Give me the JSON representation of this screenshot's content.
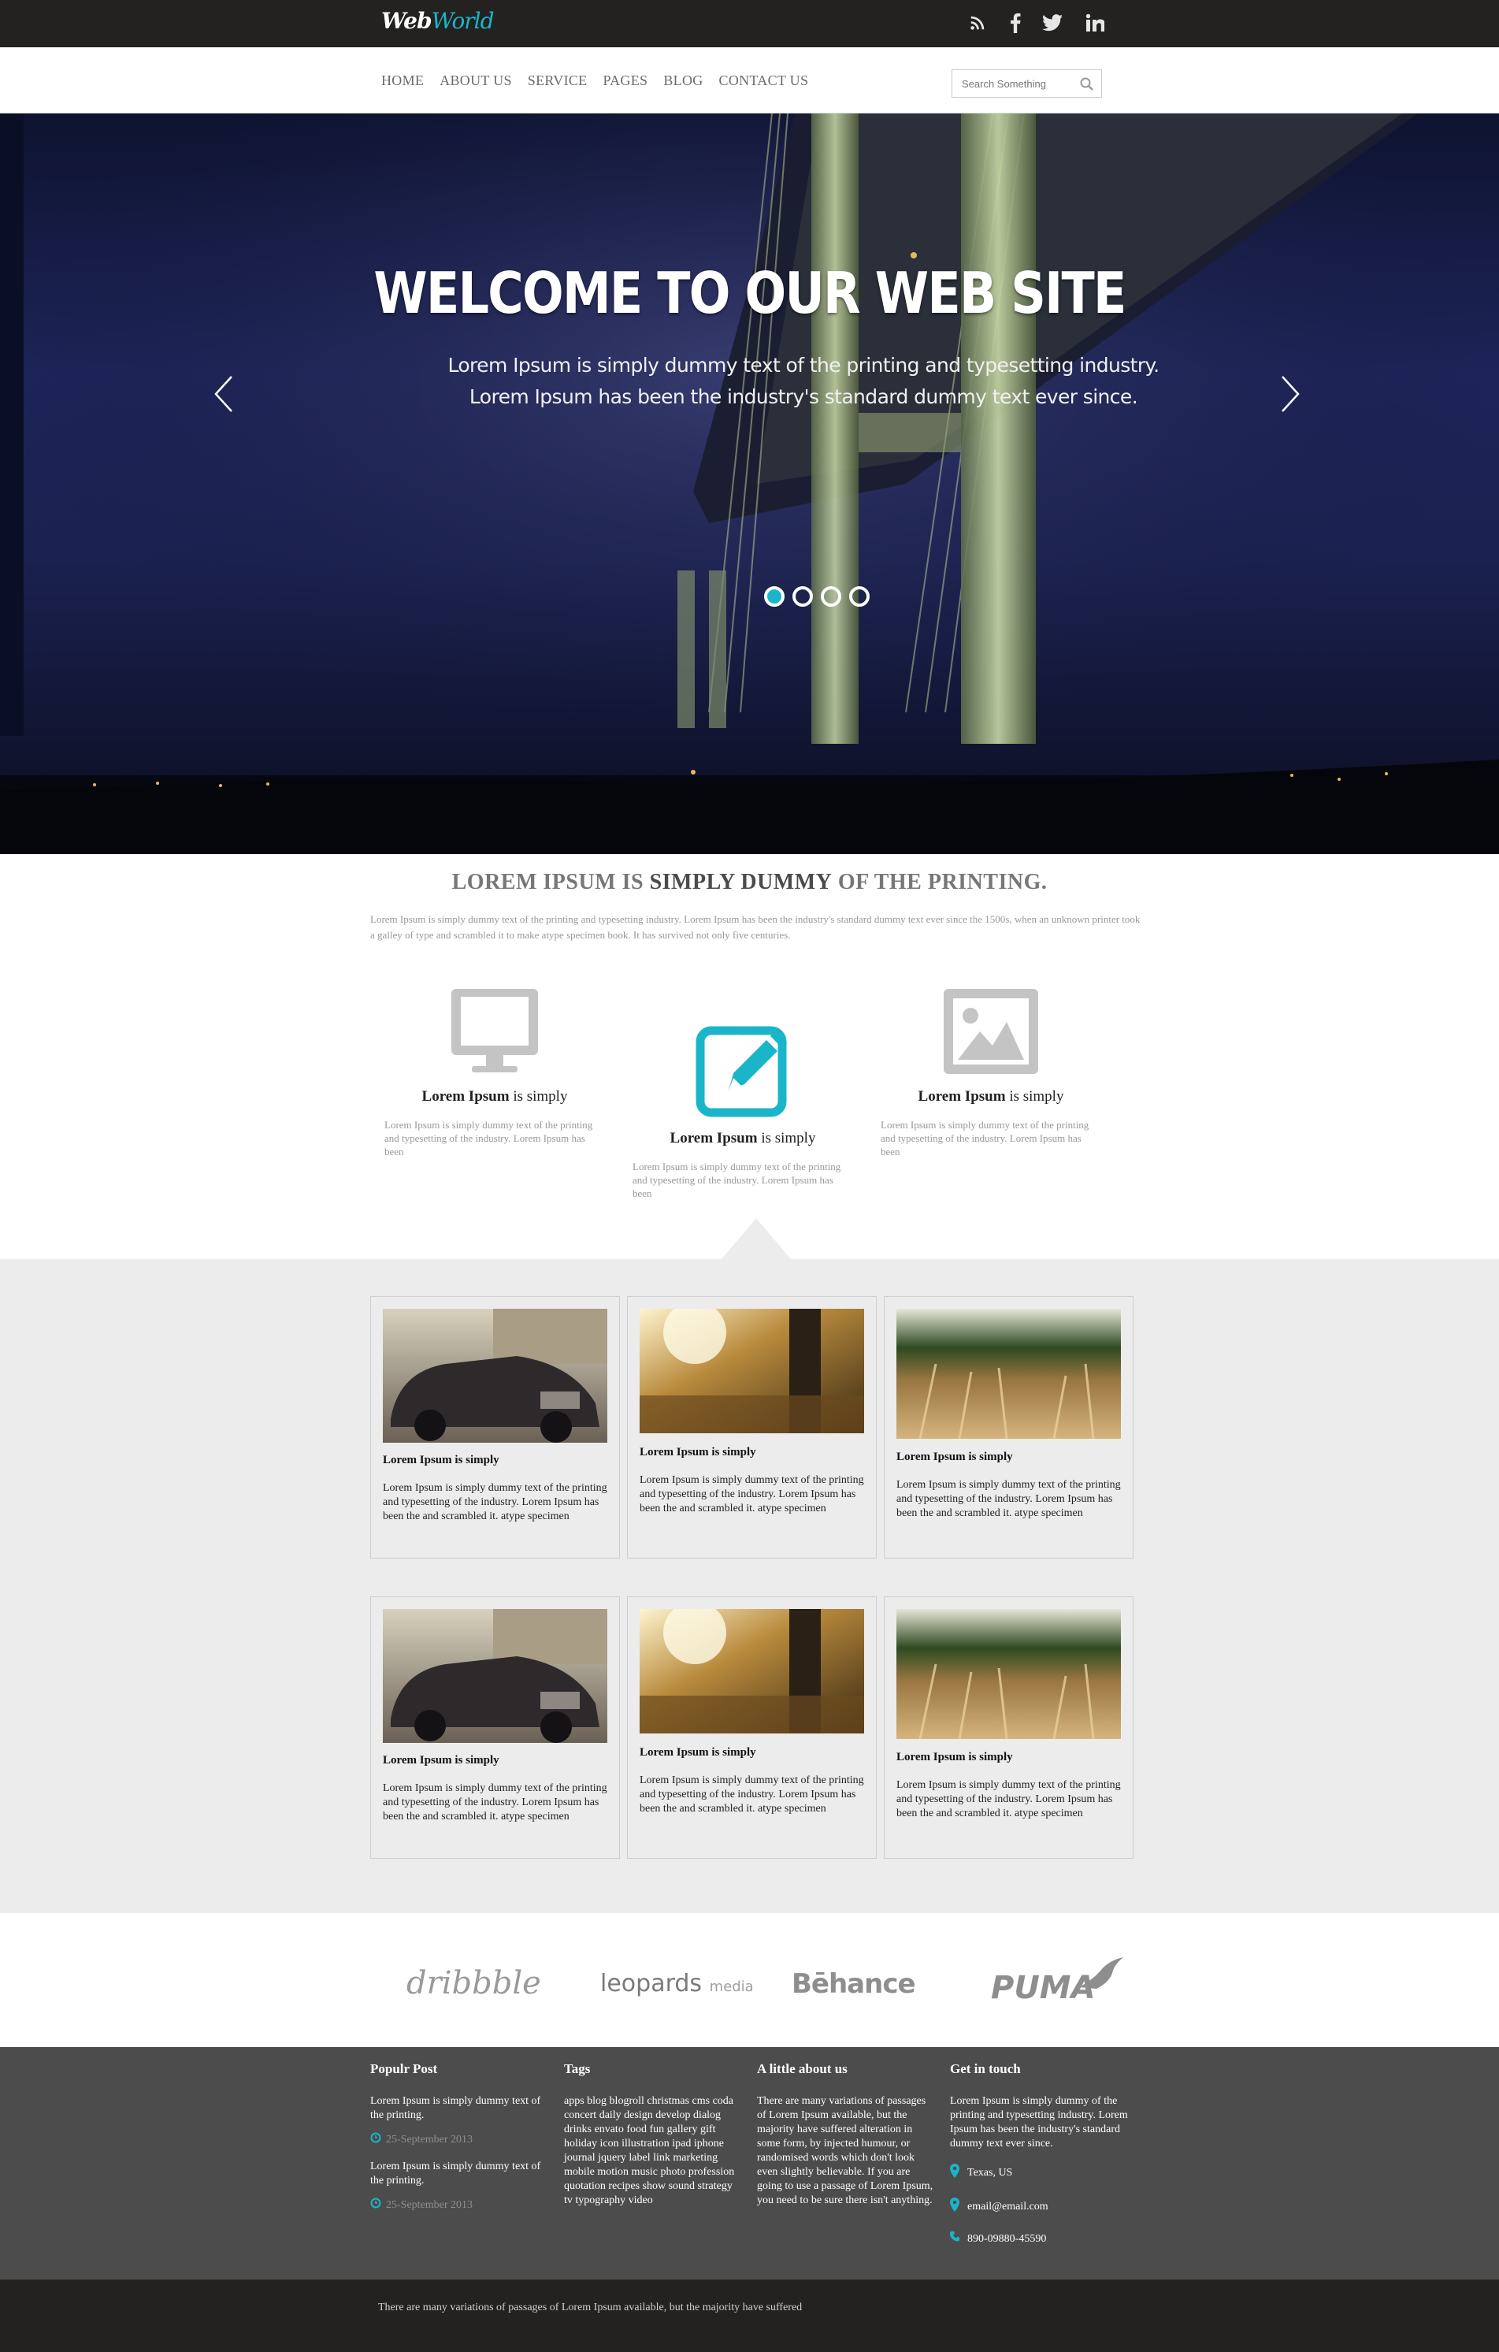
{
  "logo": {
    "part1": "Web",
    "part2": "World"
  },
  "social": [
    "rss-icon",
    "facebook-icon",
    "twitter-icon",
    "linkedin-icon"
  ],
  "nav": [
    "HOME",
    "ABOUT US",
    "SERVICE",
    "PAGES",
    "BLOG",
    "CONTACT US"
  ],
  "search": {
    "placeholder": "Search Something"
  },
  "hero": {
    "title": "WELCOME TO OUR WEB SITE",
    "text": "Lorem Ipsum is simply dummy text of the printing and typesetting industry. Lorem Ipsum has been the industry's standard dummy text ever since.",
    "dots": 4,
    "active_dot": 1
  },
  "intro": {
    "title_a": "LOREM IPSUM IS ",
    "title_b": "SIMPLY DUMMY",
    "title_c": " OF THE PRINTING.",
    "text": "Lorem Ipsum is simply dummy text of the printing and typesetting industry. Lorem Ipsum has been the industry's standard dummy text ever since the 1500s, when an unknown printer took a galley of type and scrambled it to make atype specimen book. It has survived not only five centuries."
  },
  "features": [
    {
      "icon": "monitor-icon",
      "title_bold": "Lorem Ipsum",
      "title_rest": " is simply",
      "desc": "Lorem Ipsum is simply dummy text of the printing and typesetting of the industry. Lorem Ipsum has been"
    },
    {
      "icon": "edit-icon",
      "title_bold": "Lorem Ipsum",
      "title_rest": " is simply",
      "desc": "Lorem Ipsum is simply dummy text of the printing and typesetting of the industry. Lorem Ipsum has been",
      "accent": "#1bb5c9"
    },
    {
      "icon": "image-icon",
      "title_bold": "Lorem Ipsum",
      "title_rest": " is simply",
      "desc": "Lorem Ipsum is simply dummy text of the printing and typesetting of the industry. Lorem Ipsum has been"
    }
  ],
  "cards": [
    {
      "image": "vintage-car-photo",
      "title": "Lorem Ipsum is simply",
      "desc": "Lorem Ipsum is simply dummy text of the printing and typesetting of the industry. Lorem Ipsum has been the and scrambled it. atype specimen"
    },
    {
      "image": "sunlit-forest-photo",
      "title": "Lorem Ipsum is simply",
      "desc": "Lorem Ipsum is simply dummy text of the printing and typesetting of the industry. Lorem Ipsum has been the and scrambled it. atype specimen"
    },
    {
      "image": "wheat-field-photo",
      "title": "Lorem Ipsum is simply",
      "desc": "Lorem Ipsum is simply dummy text of the printing and typesetting of the industry. Lorem Ipsum has been the and scrambled it. atype specimen"
    },
    {
      "image": "vintage-car-photo",
      "title": "Lorem Ipsum is simply",
      "desc": "Lorem Ipsum is simply dummy text of the printing and typesetting of the industry. Lorem Ipsum has been the and scrambled it. atype specimen"
    },
    {
      "image": "sunlit-forest-photo",
      "title": "Lorem Ipsum is simply",
      "desc": "Lorem Ipsum is simply dummy text of the printing and typesetting of the industry. Lorem Ipsum has been the and scrambled it. atype specimen"
    },
    {
      "image": "wheat-field-photo",
      "title": "Lorem Ipsum is simply",
      "desc": "Lorem Ipsum is simply dummy text of the printing and typesetting of the industry. Lorem Ipsum has been the and scrambled it. atype specimen"
    }
  ],
  "brands": [
    {
      "name": "dribbble",
      "icon": "dribbble-logo"
    },
    {
      "name": "leopards",
      "suffix": "media",
      "icon": "leopards-media-logo"
    },
    {
      "name": "Bēhance",
      "icon": "behance-logo"
    },
    {
      "name": "PUMA",
      "icon": "puma-logo"
    }
  ],
  "footer": {
    "popular": {
      "title": "Populr Post",
      "posts": [
        {
          "text": "Lorem Ipsum is simply dummy text of the printing.",
          "date": "25-September 2013"
        },
        {
          "text": "Lorem Ipsum is simply dummy text of the printing.",
          "date": "25-September 2013"
        }
      ]
    },
    "tags": {
      "title": "Tags",
      "text": "apps blog blogroll christmas cms coda concert daily design develop dialog drinks envato food fun gallery gift holiday icon illustration ipad iphone journal jquery label link marketing mobile motion music photo profession quotation recipes show sound strategy tv typography video"
    },
    "about": {
      "title": "A little about us",
      "text": "There are many variations of passages of Lorem Ipsum available, but the majority have suffered alteration in some form, by injected humour, or randomised words which don't look even slightly believable. If you are going to use a passage of Lorem Ipsum, you need to be sure there isn't anything."
    },
    "contact": {
      "title": "Get in touch",
      "text": "Lorem Ipsum is simply dummy of the printing and typesetting industry. Lorem Ipsum has been the industry's standard dummy text ever since.",
      "location": "Texas, US",
      "email": "email@email.com",
      "phone": "890-09880-45590"
    }
  },
  "bottom": {
    "text": "There are many variations of passages of Lorem Ipsum available, but the majority have suffered"
  },
  "colors": {
    "accent": "#1bb5c9",
    "topbar": "#232221",
    "footer": "#4c4c4c",
    "grey_section": "#ececec"
  }
}
